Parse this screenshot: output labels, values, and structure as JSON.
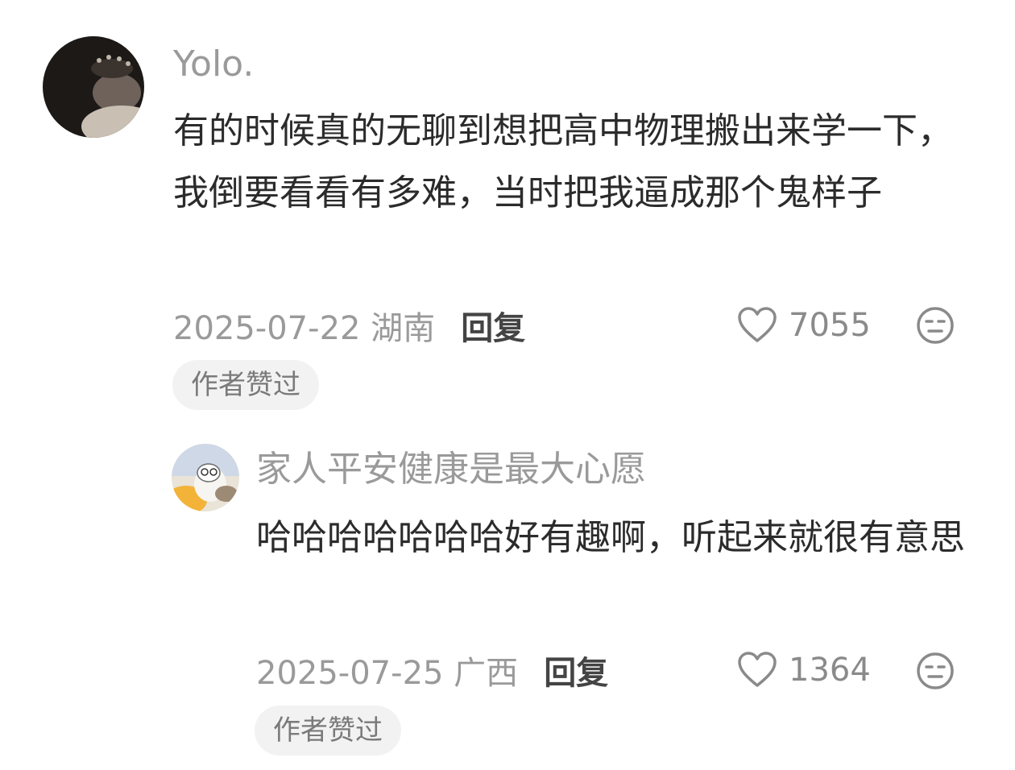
{
  "comments": [
    {
      "username": "Yolo.",
      "content": "有的时候真的无聊到想把高中物理搬出来学一下，我倒要看看有多难，当时把我逼成那个鬼样子",
      "date_location": "2025-07-22 湖南",
      "reply_label": "回复",
      "likes": "7055",
      "badge": "作者赞过"
    },
    {
      "username": "家人平安健康是最大心愿",
      "content": "哈哈哈哈哈哈哈好有趣啊，听起来就很有意思",
      "date_location": "2025-07-25 广西",
      "reply_label": "回复",
      "likes": "1364",
      "badge": "作者赞过"
    }
  ],
  "icons": {
    "like": "heart-outline-icon",
    "dislike": "neutral-face-icon"
  },
  "colors": {
    "username": "#9a9a9a",
    "content": "#2b2b2b",
    "meta": "#9a9a9a",
    "badge_bg": "#f2f2f2"
  }
}
